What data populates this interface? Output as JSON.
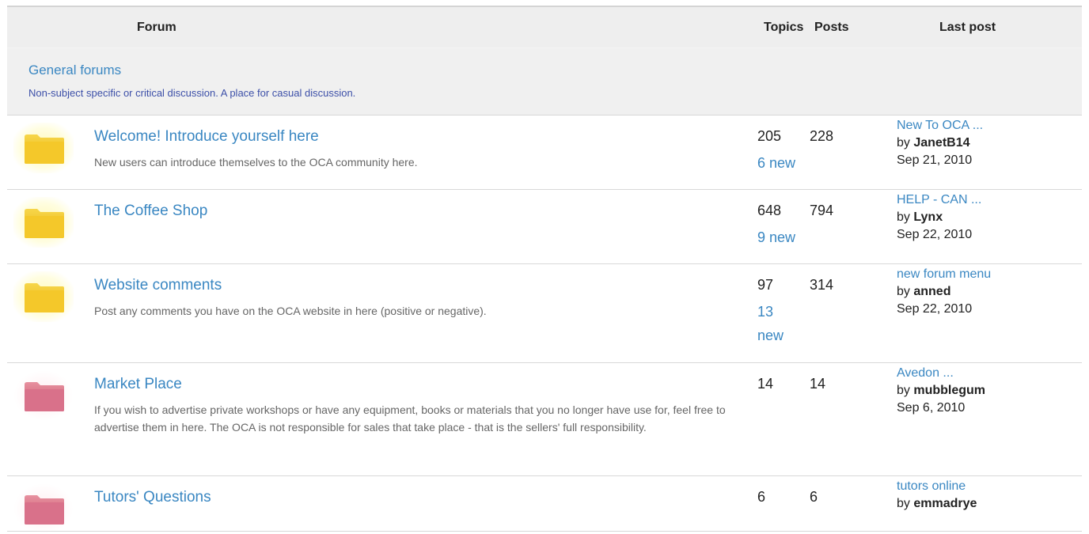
{
  "header": {
    "forum": "Forum",
    "topics": "Topics",
    "posts": "Posts",
    "last_post": "Last post"
  },
  "category": {
    "title": "General forums",
    "description": "Non-subject specific or critical discussion. A place for casual discussion."
  },
  "forums": [
    {
      "title": "Welcome! Introduce yourself here",
      "description": "New users can introduce themselves to the OCA community here.",
      "topics": "205",
      "new": "6 new",
      "posts": "228",
      "last_title": "New To OCA ...",
      "last_by_prefix": "by ",
      "last_user": "JanetB14",
      "last_date": "Sep 21, 2010",
      "icon": "folder-yellow-icon"
    },
    {
      "title": "The Coffee Shop",
      "description": "",
      "topics": "648",
      "new": "9 new",
      "posts": "794",
      "last_title": "HELP - CAN ...",
      "last_by_prefix": "by ",
      "last_user": "Lynx",
      "last_date": "Sep 22, 2010",
      "icon": "folder-yellow-icon"
    },
    {
      "title": "Website comments",
      "description": "Post any comments you have on the OCA website in here (positive or negative).",
      "topics": "97",
      "new": "13 new",
      "posts": "314",
      "last_title": "new forum menu",
      "last_by_prefix": "by ",
      "last_user": "anned",
      "last_date": "Sep 22, 2010",
      "icon": "folder-yellow-icon"
    },
    {
      "title": "Market Place",
      "description": "If you wish to advertise private workshops or have any equipment, books or materials that you no longer have use for, feel free to advertise them in here. The OCA is not responsible for sales that take place - that is the sellers' full responsibility.",
      "topics": "14",
      "new": "",
      "posts": "14",
      "last_title": "Avedon ...",
      "last_by_prefix": "by ",
      "last_user": "mubblegum",
      "last_date": "Sep 6, 2010",
      "icon": "folder-red-icon"
    },
    {
      "title": "Tutors' Questions",
      "description": "",
      "topics": "6",
      "new": "",
      "posts": "6",
      "last_title": "tutors online",
      "last_by_prefix": "by ",
      "last_user": "emmadrye",
      "last_date": "",
      "icon": "folder-red-icon"
    }
  ],
  "colors": {
    "link": "#3a87c2",
    "folder_yellow": "#f2c21b",
    "folder_red": "#d8677c"
  }
}
